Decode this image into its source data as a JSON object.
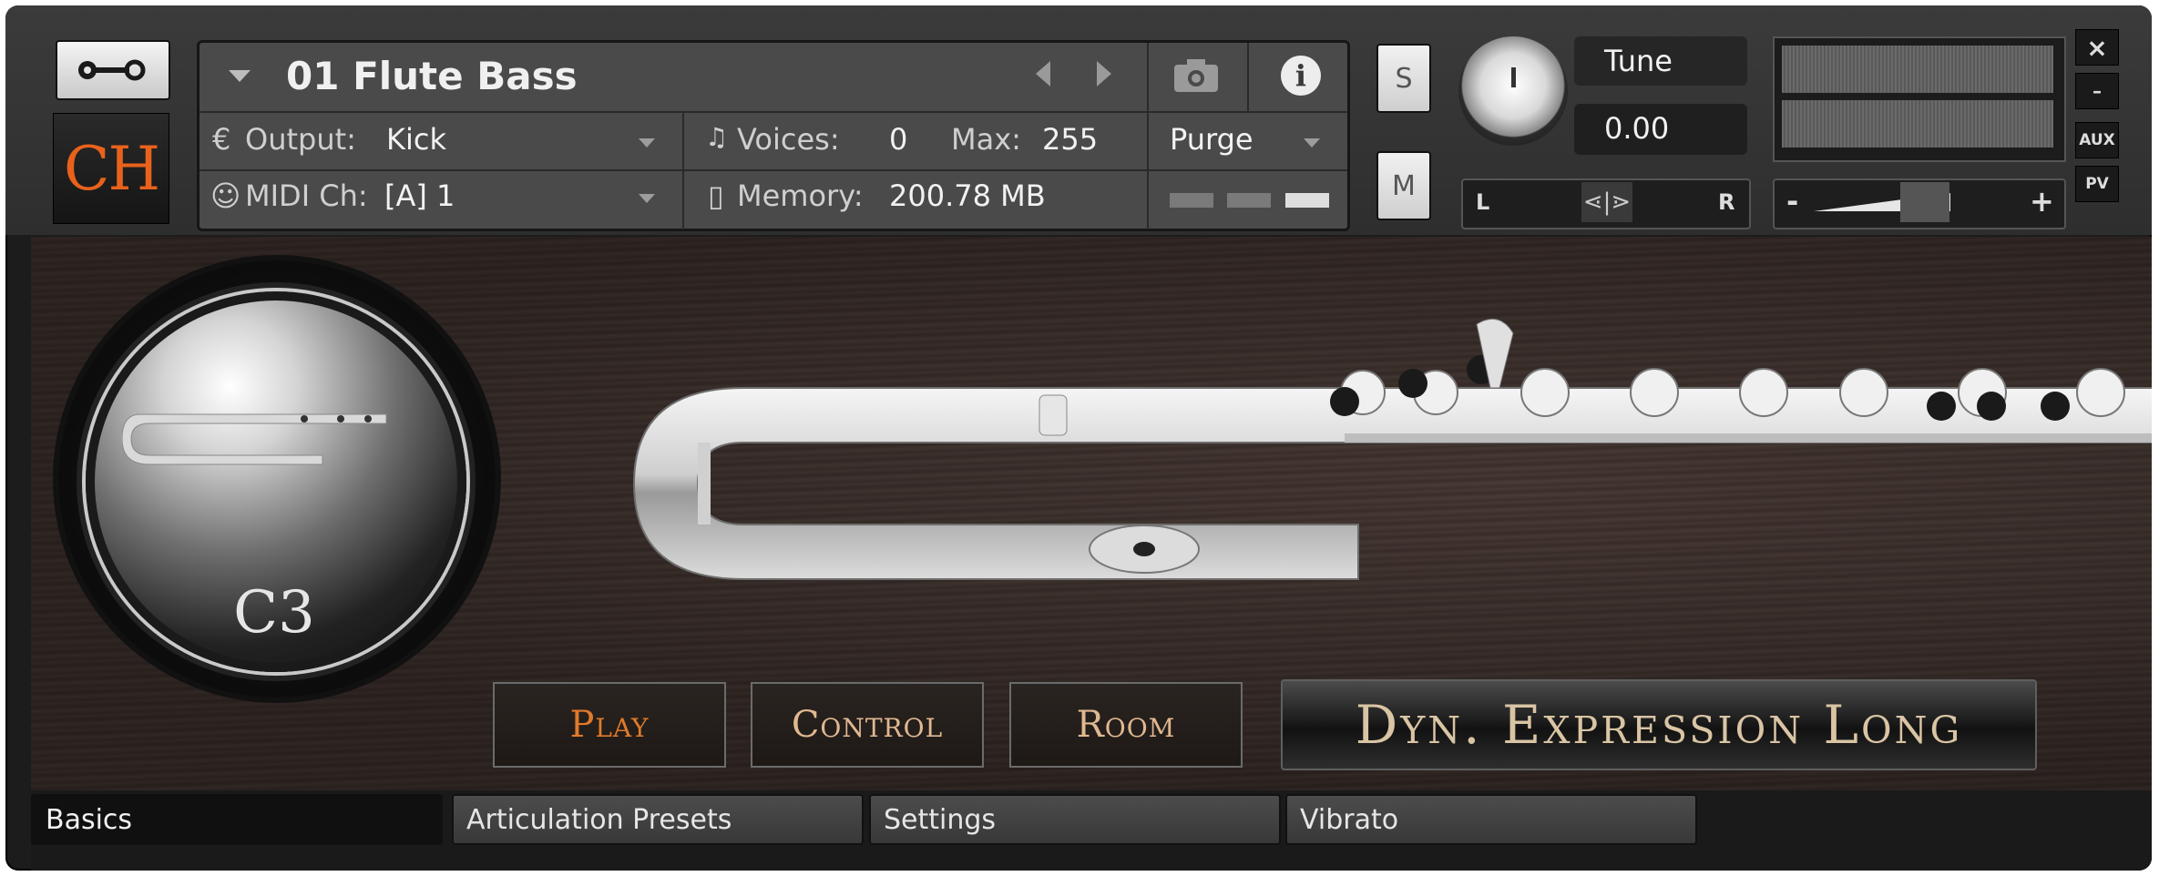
{
  "instrument": {
    "name": "01 Flute Bass",
    "logo_text": "CH"
  },
  "header": {
    "output_label": "Output:",
    "output_value": "Kick",
    "midi_label": "MIDI Ch:",
    "midi_value": "[A]  1",
    "voices_label": "Voices:",
    "voices_value": "0",
    "max_label": "Max:",
    "max_value": "255",
    "memory_label": "Memory:",
    "memory_value": "200.78 MB",
    "purge_label": "Purge",
    "solo_label": "S",
    "mute_label": "M",
    "tune_label": "Tune",
    "tune_value": "0.00",
    "pan_left": "L",
    "pan_right": "R",
    "vol_minus": "-",
    "vol_plus": "+",
    "aux_label": "AUX",
    "pv_label": "PV",
    "close_label": "×",
    "minimize_label": "–"
  },
  "body": {
    "note_badge": "C3",
    "mode_buttons": [
      {
        "label": "Play",
        "color": "#e07a2a"
      },
      {
        "label": "Control",
        "color": "#e0b890"
      },
      {
        "label": "Room",
        "color": "#e0b890"
      }
    ],
    "articulation": "Dyn. Expression Long"
  },
  "tabs": [
    {
      "label": "Basics",
      "active": true
    },
    {
      "label": "Articulation Presets",
      "active": false
    },
    {
      "label": "Settings",
      "active": false
    },
    {
      "label": "Vibrato",
      "active": false
    }
  ],
  "colors": {
    "accent": "#e8621c",
    "articulation_text": "#d9c4a4"
  },
  "icons": [
    "wrench-icon",
    "camera-icon",
    "info-icon",
    "output-icon",
    "midi-icon",
    "voices-icon",
    "memory-icon"
  ]
}
